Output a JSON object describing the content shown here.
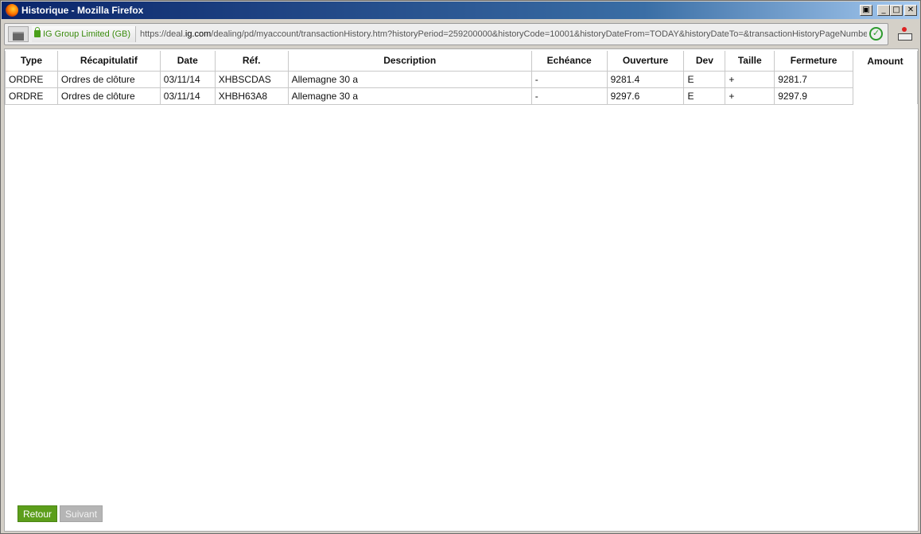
{
  "window": {
    "title": "Historique - Mozilla Firefox"
  },
  "urlbar": {
    "identity": "IG Group Limited (GB)",
    "url_prefix": "https://deal.",
    "url_domain": "ig.com",
    "url_rest": "/dealing/pd/myaccount/transactionHistory.htm?historyPeriod=259200000&historyCode=10001&historyDateFrom=TODAY&historyDateTo=&transactionHistoryPageNumbe"
  },
  "table": {
    "headers": [
      "Type",
      "Récapitulatif",
      "Date",
      "Réf.",
      "Description",
      "Echéance",
      "Ouverture",
      "Dev",
      "Taille",
      "Fermeture",
      "Amount"
    ],
    "rows": [
      {
        "type": "ORDRE",
        "recap": "Ordres de clôture",
        "date": "03/11/14",
        "ref": "XHBSCDAS",
        "desc": "Allemagne 30 a",
        "echeance": "-",
        "ouverture": "9281.4",
        "dev": "E",
        "taille": "+",
        "fermeture": "9281.7",
        "amount": ""
      },
      {
        "type": "ORDRE",
        "recap": "Ordres de clôture",
        "date": "03/11/14",
        "ref": "XHBH63A8",
        "desc": "Allemagne 30 a",
        "echeance": "-",
        "ouverture": "9297.6",
        "dev": "E",
        "taille": "+",
        "fermeture": "9297.9",
        "amount": ""
      }
    ]
  },
  "buttons": {
    "back": "Retour",
    "next": "Suivant"
  },
  "colors": {
    "accent_green": "#5c9e1b",
    "disabled_gray": "#b5b5b5",
    "secure_green": "#3a8b0d"
  }
}
